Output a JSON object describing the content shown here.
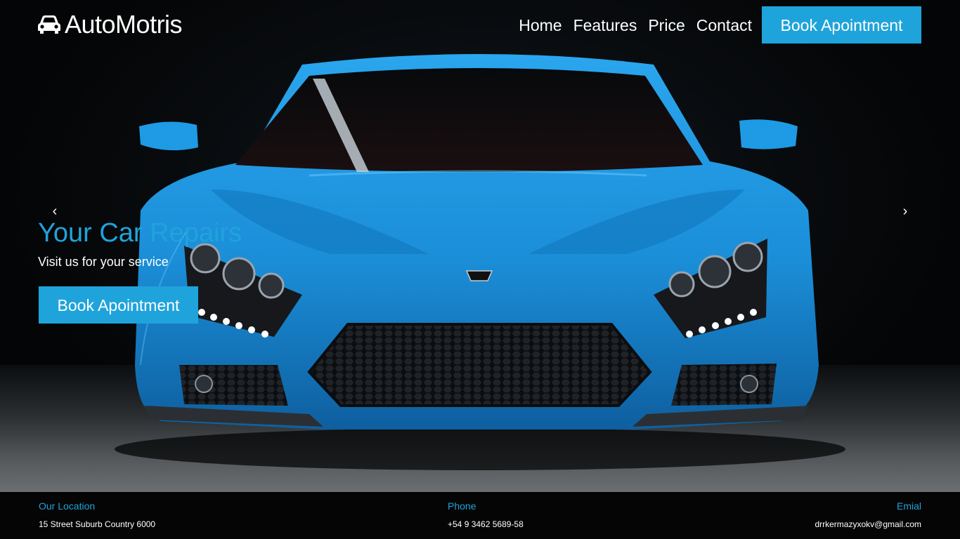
{
  "brand": {
    "name": "AutoMotris",
    "icon": "car-icon"
  },
  "nav": {
    "items": [
      {
        "label": "Home"
      },
      {
        "label": "Features"
      },
      {
        "label": "Price"
      },
      {
        "label": "Contact"
      }
    ],
    "cta_label": "Book Apointment"
  },
  "hero": {
    "title": "Your Car Repairs",
    "subtitle": "Visit us for your service",
    "cta_label": "Book Apointment",
    "prev_icon": "chevron-left-icon",
    "next_icon": "chevron-right-icon",
    "prev_glyph": "‹",
    "next_glyph": "›",
    "image": "blue sports car front view"
  },
  "footer": {
    "location_label": "Our Location",
    "location_value": "15 Street Suburb Country 6000",
    "phone_label": "Phone",
    "phone_value": "+54 9 3462 5689-58",
    "email_label": "Emial",
    "email_value": "drrkermazyxokv@gmail.com"
  },
  "colors": {
    "accent": "#1fa3db",
    "background": "#000000",
    "text": "#ffffff",
    "car": "#1e9be0"
  }
}
